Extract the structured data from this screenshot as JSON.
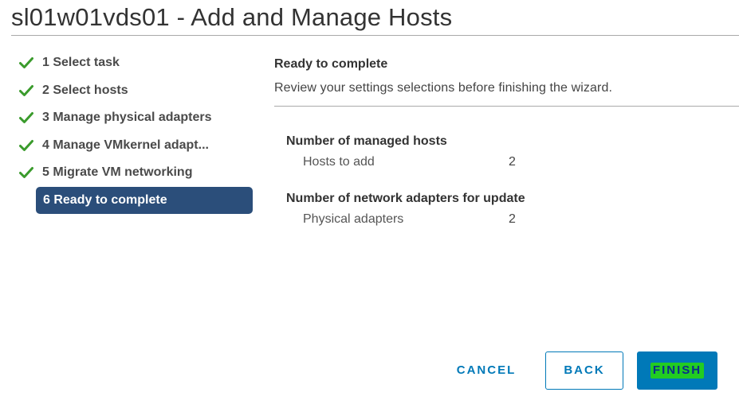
{
  "dialog": {
    "title": "sl01w01vds01 - Add and Manage Hosts"
  },
  "steps": [
    {
      "label": "1 Select task",
      "completed": true
    },
    {
      "label": "2 Select hosts",
      "completed": true
    },
    {
      "label": "3 Manage physical adapters",
      "completed": true
    },
    {
      "label": "4 Manage VMkernel adapt...",
      "completed": true
    },
    {
      "label": "5 Migrate VM networking",
      "completed": true
    },
    {
      "label": "6 Ready to complete",
      "completed": false,
      "active": true
    }
  ],
  "content": {
    "title": "Ready to complete",
    "description": "Review your settings selections before finishing the wizard.",
    "groups": [
      {
        "title": "Number of managed hosts",
        "rows": [
          {
            "key": "Hosts to add",
            "value": "2"
          }
        ]
      },
      {
        "title": "Number of network adapters for update",
        "rows": [
          {
            "key": "Physical adapters",
            "value": "2"
          }
        ]
      }
    ]
  },
  "buttons": {
    "cancel": "CANCEL",
    "back": "BACK",
    "finish": "FINISH"
  },
  "colors": {
    "primary": "#0079b8",
    "active_step": "#2b4e7a",
    "check": "#3a9b2c",
    "highlight": "#22cc22"
  },
  "icons": {
    "completed_step": "check-icon"
  }
}
